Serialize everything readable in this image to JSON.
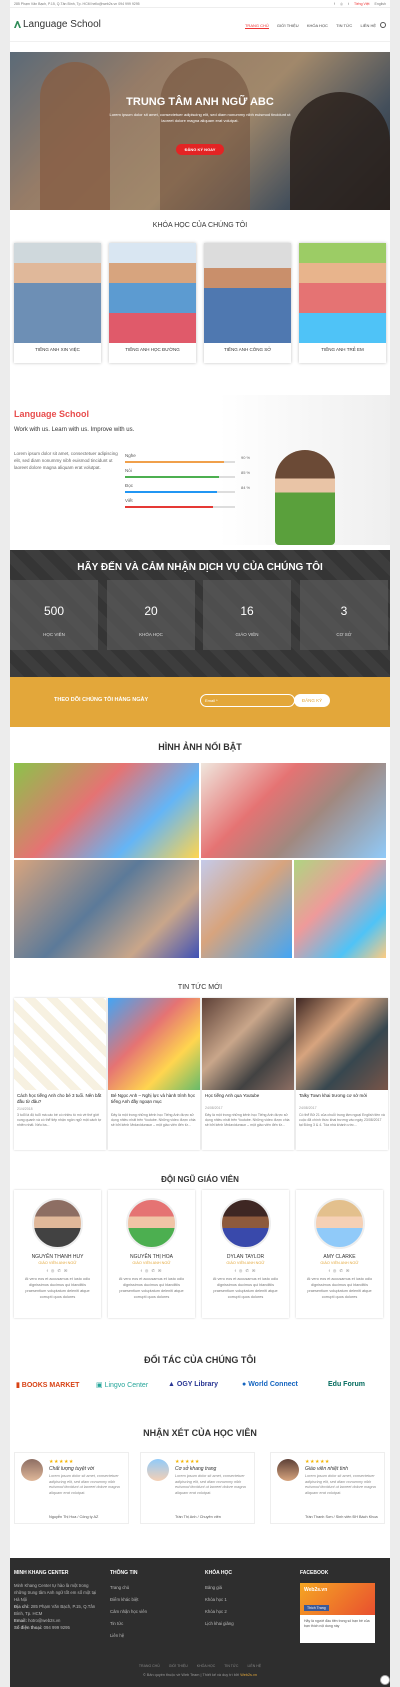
{
  "topbar": {
    "contact": "285 Phạm Văn Bạch, P.15, Q.Tân Bình, Tp. HCM   hello@web2s.vn   094 999 9295",
    "lang_vi": "Tiếng Việt",
    "lang_en": "English"
  },
  "header": {
    "logo": "Language School",
    "nav": [
      "TRANG CHỦ",
      "GIỚI THIỆU",
      "KHÓA HỌC",
      "TIN TỨC",
      "LIÊN HỆ"
    ]
  },
  "hero": {
    "title": "TRUNG TÂM ANH NGỮ ABC",
    "text": "Lorem ipsum dolor sit amet, consectetuer adipiscing elit, sed diam nonummy nibh euismod tincidunt ut laoreet dolore magna aliquam erat volutpat.",
    "button": "ĐĂNG KÝ NGAY"
  },
  "courses": {
    "title": "KHÓA HỌC CỦA CHÚNG TÔI",
    "items": [
      "TIẾNG ANH XIN VIỆC",
      "TIẾNG ANH HỌC ĐƯỜNG",
      "TIẾNG ANH CÔNG SỞ",
      "TIẾNG ANH TRẺ EM"
    ]
  },
  "school": {
    "title": "Language School",
    "subtitle": "Work with us. Learn with us. Improve with us.",
    "desc": "Lorem ipsum dolor sit amet, consectetuer adipiscing elit, sed diam nonummy nibh euismod tincidunt ut laoreet dolore magna aliquam erat volutpat.",
    "skills": [
      {
        "name": "Nghe",
        "pct": "90 %",
        "value": 90,
        "color": "#f0a04b"
      },
      {
        "name": "Nói",
        "pct": "85 %",
        "value": 85,
        "color": "#4caf50"
      },
      {
        "name": "Đọc",
        "pct": "84 %",
        "value": 84,
        "color": "#2196f3"
      },
      {
        "name": "Viết",
        "pct": "",
        "value": 80,
        "color": "#e53935"
      }
    ]
  },
  "services": {
    "title": "HÃY ĐẾN VÀ CẢM NHẬN DỊCH VỤ CỦA CHÚNG TÔI",
    "stats": [
      {
        "num": "500",
        "label": "HỌC VIÊN"
      },
      {
        "num": "20",
        "label": "KHÓA HỌC"
      },
      {
        "num": "16",
        "label": "GIÁO VIÊN"
      },
      {
        "num": "3",
        "label": "CƠ SỞ"
      }
    ]
  },
  "subscribe": {
    "text": "THEO DÕI CHÚNG TÔI HÀNG NGÀY",
    "placeholder": "Email *",
    "button": "ĐĂNG KÝ"
  },
  "gallery": {
    "title": "HÌNH ẢNH NỔI BẬT"
  },
  "news": {
    "title": "TIN TỨC MỚI",
    "items": [
      {
        "title": "Cách học tiếng Anh cho bé 3 tuổi. Nên bắt đầu từ đâu?",
        "date": "21/4/2018",
        "excerpt": "3 tuổi là độ tuổi mà các bé có nhiều tò mò về thế giới xung quanh và có thể tiếp nhận ngôn ngữ một cách tự nhiên nhất. Nếu ba..."
      },
      {
        "title": "Bé Ngọc Anh – Nghị lực và hành trình học tiếng Anh đầy ngoạn mục",
        "date": "GIÁO VIÊN",
        "excerpt": "Đây là một trong những kênh học Tiếng Anh được sử dụng nhiều nhất trên Youtube. Những video được chia sẻ bởi kênh Mrdavidunsun – một giáo viên đến từ..."
      },
      {
        "title": "Học tiếng Anh qua Youtube",
        "date": "24/08/2017",
        "excerpt": "Đây là một trong những kênh học Tiếng Anh được sử dụng nhiều nhất trên Youtube. Những video được chia sẻ bởi kênh Mrdavidunsun – một giáo viên đến từ..."
      },
      {
        "title": "Talky Town khai trương cơ sở mới",
        "date": "24/08/2017",
        "excerpt": "Có thể Bữ 21 của chuỗi trung tâm ngoại English tiền và cuộc đã chính thức khai trương vào ngày 23/08/2017 tại Đông 3 & 4. Tòa nhà khánh ước..."
      }
    ]
  },
  "teachers": {
    "title": "ĐỘI NGŨ GIÁO VIÊN",
    "items": [
      {
        "name": "NGUYỄN THANH HUY",
        "role": "GIÁO VIÊN ANH NGỮ"
      },
      {
        "name": "NGUYỄN THỊ HOA",
        "role": "GIÁO VIÊN ANH NGỮ"
      },
      {
        "name": "DYLAN TAYLOR",
        "role": "GIÁO VIÊN ANH NGỮ"
      },
      {
        "name": "AMY CLARKE",
        "role": "GIÁO VIÊN ANH NGỮ"
      }
    ],
    "bio": "At vero eos et accusamus et iusto odio dignissimos ducimus qui blanditiis praesentium voluptatum deleniti atque corrupti quos dolores",
    "socials": "f ◎ ✆ ✉"
  },
  "partners": {
    "title": "ĐỐI TÁC CỦA CHÚNG TÔI",
    "items": [
      "BOOKS MARKET",
      "Lingvo Center",
      "OGY Library",
      "World Connect",
      "Edu Forum"
    ]
  },
  "testimonials": {
    "title": "NHẬN XÉT CỦA HỌC VIÊN",
    "stars": "★★★★★",
    "body": "Lorem ipsum dolor sit amet, consectetuer adipiscing elit, sed diam nonummy nibh euismod tincidunt ut laoreet dolore magna aliquam erat volutpat.",
    "items": [
      {
        "quote": "Chất lượng tuyệt vời",
        "author": "Nguyễn Thị Hoa / Công ty AZ"
      },
      {
        "quote": "Cơ sở khang trang",
        "author": "Trần Thị Anh / Chuyên viên"
      },
      {
        "quote": "Giáo viên nhiệt tình",
        "author": "Trần Thanh Sơn / Sinh viên ĐH Bách Khoa"
      }
    ]
  },
  "footer": {
    "col1_title": "MINH KHANG CENTER",
    "col1_text": "Minh Khang Center tự hào là một trong những trung tâm Anh ngữ tốt em số một tại Hà Nội",
    "address_label": "Địa chỉ:",
    "address": "285 Phạm Văn Bạch, P.15, Q.Tân Bình, Tp. HCM",
    "email_label": "Email:",
    "email": "hotro@web2s.vn",
    "phone_label": "Số điện thoại:",
    "phone": "094 999 9295",
    "col2_title": "THÔNG TIN",
    "col2_links": [
      "Trang chủ",
      "Điểm khác biệt",
      "Cảm nhận học viên",
      "Tin tức",
      "Liên hệ"
    ],
    "col3_title": "KHÓA HỌC",
    "col3_links": [
      "Bảng giá",
      "Khóa học 1",
      "Khóa học 2",
      "Lịch khai giảng"
    ],
    "col4_title": "FACEBOOK",
    "fb_name": "Web2s.vn",
    "fb_like": "Thích Trang",
    "fb_text": "Hãy là người đầu tiên trong số bạn bè của bạn thích nội dung này",
    "bottom_links": [
      "TRANG CHỦ",
      "GIỚI THIỆU",
      "KHÓA HỌC",
      "TIN TỨC",
      "LIÊN HỆ"
    ],
    "copyright": "© Bản quyền thuộc về Web Team | Thiết kế và duy trì bởi",
    "copyright_brand": "Web2s.vn"
  }
}
